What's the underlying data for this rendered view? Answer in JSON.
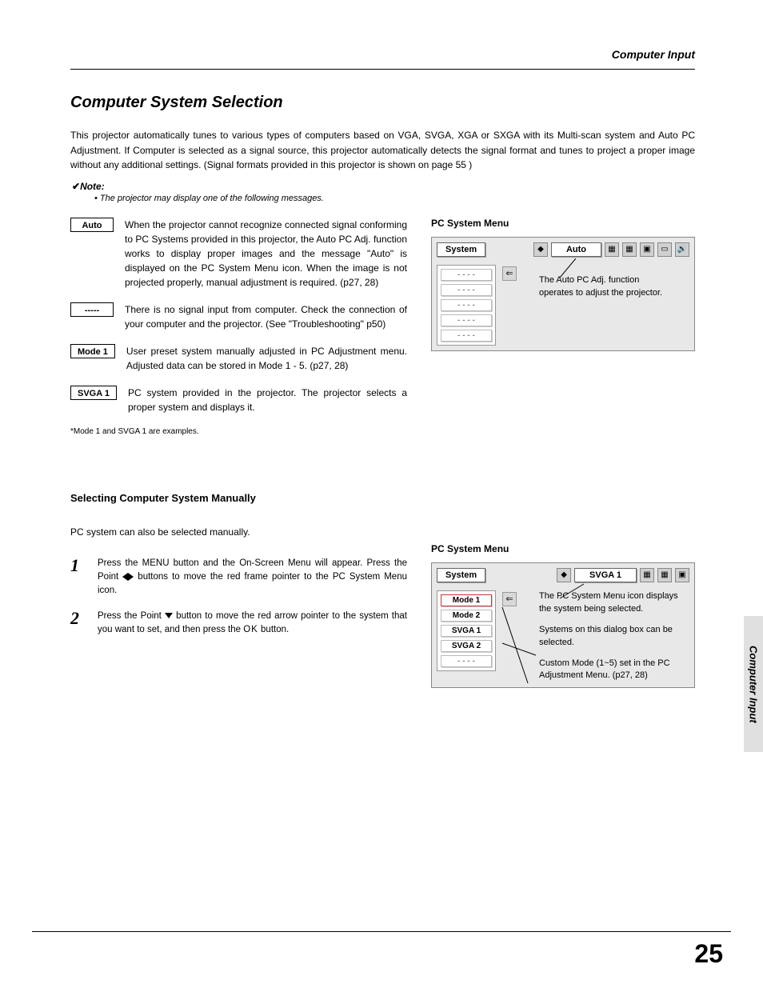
{
  "header": {
    "section": "Computer Input"
  },
  "title": "Computer System Selection",
  "intro": "This projector automatically tunes to various types of computers based on VGA, SVGA, XGA or SXGA with its Multi-scan system and Auto PC Adjustment.  If Computer is selected as a signal source, this projector automatically detects the signal format and tunes to project a proper image without any additional settings.  (Signal formats provided in this projector is shown on page 55 )",
  "note": {
    "head": "Note:",
    "bullet": "• The projector may display one of the following messages."
  },
  "items": [
    {
      "badge": "Auto",
      "text": "When the projector cannot recognize connected signal conforming to PC Systems provided in this projector, the Auto PC Adj. function works to display proper images and the message \"Auto\" is displayed on the PC System Menu icon.  When the image is not projected properly, manual adjustment is required. (p27, 28)"
    },
    {
      "badge": "-----",
      "text": "There is no signal input from computer.  Check the connection of your computer and the projector.  (See \"Troubleshooting\" p50)"
    },
    {
      "badge": "Mode 1",
      "text": "User preset system manually adjusted in PC Adjustment menu.  Adjusted data can be stored in Mode 1 - 5. (p27, 28)"
    },
    {
      "badge": "SVGA 1",
      "text": "PC system provided in the projector.  The projector selects a proper system and displays it."
    }
  ],
  "footnote": "*Mode 1 and SVGA 1 are examples.",
  "manual": {
    "head": "Selecting Computer System Manually",
    "lead": "PC system can also be selected manually.",
    "steps": [
      {
        "n": "1",
        "pre": "Press the MENU button and the On-Screen Menu will appear.  Press the Point ",
        "post": " buttons to move the red frame pointer to the PC System Menu icon."
      },
      {
        "n": "2",
        "pre": "Press the Point ",
        "mid": " button to move the red arrow pointer to the system that you want to set, and then press the ",
        "ok": "OK",
        "post2": " button."
      }
    ]
  },
  "menu1": {
    "title": "PC System Menu",
    "label": "System",
    "selected": "Auto",
    "list": [
      "- - - -",
      "- - - -",
      "- - - -",
      "- - - -",
      "- - - -"
    ],
    "callout": "The Auto PC Adj. function operates to adjust the projector."
  },
  "menu2": {
    "title": "PC System Menu",
    "label": "System",
    "selected": "SVGA 1",
    "list": [
      "Mode 1",
      "Mode 2",
      "SVGA 1",
      "SVGA 2",
      "- - - -"
    ],
    "callouts": [
      "The PC System Menu icon displays the system being selected.",
      "Systems on this dialog box can be selected.",
      "Custom Mode (1~5) set in the PC Adjustment Menu. (p27, 28)"
    ]
  },
  "sidetab": "Computer Input",
  "pagenum": "25"
}
